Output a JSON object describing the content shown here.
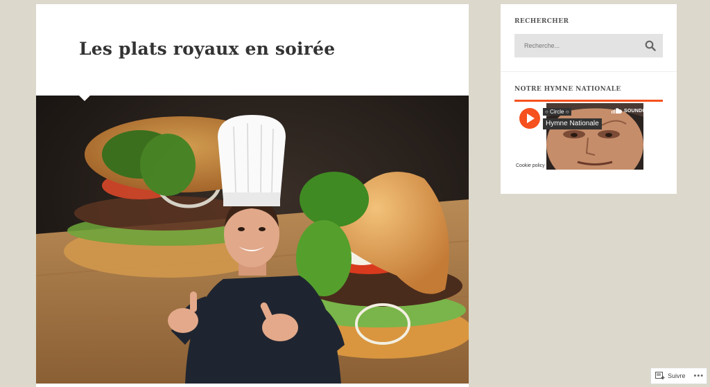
{
  "post": {
    "title": "Les plats royaux en soirée"
  },
  "sidebar": {
    "search_widget_title": "RECHERCHER",
    "search_placeholder": "Recherche...",
    "anthem_widget_title": "NOTRE HYMNE NATIONALE",
    "player": {
      "user": "○ Circle ○",
      "track": "Hymne Nationale",
      "brand": "SOUNDCLOUD",
      "cookie": "Cookie policy"
    }
  },
  "follow": {
    "label": "Suivre",
    "more": "•••"
  },
  "colors": {
    "background": "#dcd8cb",
    "soundcloud_orange": "#f5501e"
  },
  "icons": [
    "search-icon",
    "play-icon",
    "soundcloud-logo-icon",
    "follow-icon",
    "more-icon"
  ]
}
